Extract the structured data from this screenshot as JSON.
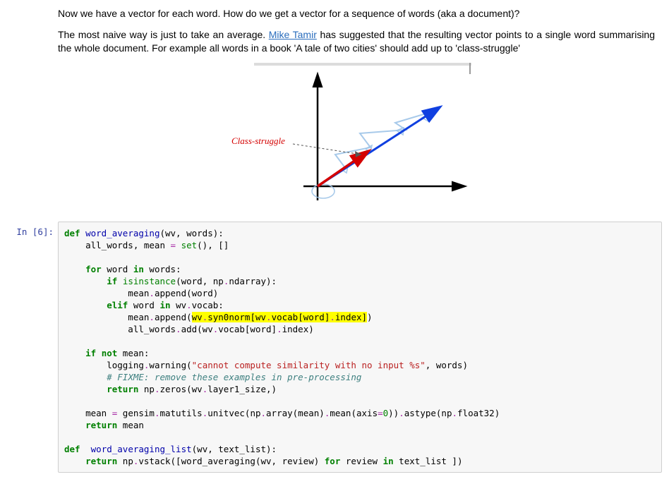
{
  "markdown": {
    "p1": "Now we have a vector for each word. How do we get a vector for a sequence of words (aka a document)?",
    "p2a": "The most naive way is just to take an average. ",
    "link_text": "Mike Tamir",
    "p2b": " has suggested that the resulting vector points to a single word summarising the whole document. For example all words in a book 'A tale of two cities' should add up to 'class-struggle'",
    "figure_label": "Class-struggle"
  },
  "code_cell": {
    "prompt": "In [6]:",
    "lines": {
      "l01a": "def",
      "l01b": " ",
      "l01c": "word_averaging",
      "l01d": "(wv, words):",
      "l02a": "    all_words, mean ",
      "l02b": "=",
      "l02c": " ",
      "l02d": "set",
      "l02e": "(), []",
      "l03": "    ",
      "l04a": "    ",
      "l04b": "for",
      "l04c": " word ",
      "l04d": "in",
      "l04e": " words:",
      "l05a": "        ",
      "l05b": "if",
      "l05c": " ",
      "l05d": "isinstance",
      "l05e": "(word, np",
      "l05f": ".",
      "l05g": "ndarray):",
      "l06a": "            mean",
      "l06b": ".",
      "l06c": "append(word)",
      "l07a": "        ",
      "l07b": "elif",
      "l07c": " word ",
      "l07d": "in",
      "l07e": " wv",
      "l07f": ".",
      "l07g": "vocab:",
      "l08a": "            mean",
      "l08b": ".",
      "l08c": "append(",
      "l08d": "wv",
      "l08e": ".",
      "l08f": "syn0norm[wv",
      "l08g": ".",
      "l08h": "vocab[word]",
      "l08i": ".",
      "l08j": "index]",
      "l08k": ")",
      "l09a": "            all_words",
      "l09b": ".",
      "l09c": "add(wv",
      "l09d": ".",
      "l09e": "vocab[word]",
      "l09f": ".",
      "l09g": "index)",
      "l10": "    ",
      "l11a": "    ",
      "l11b": "if",
      "l11c": " ",
      "l11d": "not",
      "l11e": " mean:",
      "l12a": "        logging",
      "l12b": ".",
      "l12c": "warning(",
      "l12d": "\"cannot compute similarity with no input %s\"",
      "l12e": ", words)",
      "l13a": "        ",
      "l13b": "# FIXME: remove these examples in pre-processing",
      "l14a": "        ",
      "l14b": "return",
      "l14c": " np",
      "l14d": ".",
      "l14e": "zeros(wv",
      "l14f": ".",
      "l14g": "layer1_size,)",
      "l15": "",
      "l16a": "    mean ",
      "l16b": "=",
      "l16c": " gensim",
      "l16d": ".",
      "l16e": "matutils",
      "l16f": ".",
      "l16g": "unitvec(np",
      "l16h": ".",
      "l16i": "array(mean)",
      "l16j": ".",
      "l16k": "mean(axis",
      "l16l": "=",
      "l16m": "0",
      "l16n": "))",
      "l16o": ".",
      "l16p": "astype(np",
      "l16q": ".",
      "l16r": "float32)",
      "l17a": "    ",
      "l17b": "return",
      "l17c": " mean",
      "l18": "",
      "l19a": "def",
      "l19b": "  ",
      "l19c": "word_averaging_list",
      "l19d": "(wv, text_list):",
      "l20a": "    ",
      "l20b": "return",
      "l20c": " np",
      "l20d": ".",
      "l20e": "vstack([word_averaging(wv, review) ",
      "l20f": "for",
      "l20g": " review ",
      "l20h": "in",
      "l20i": " text_list ])"
    }
  }
}
